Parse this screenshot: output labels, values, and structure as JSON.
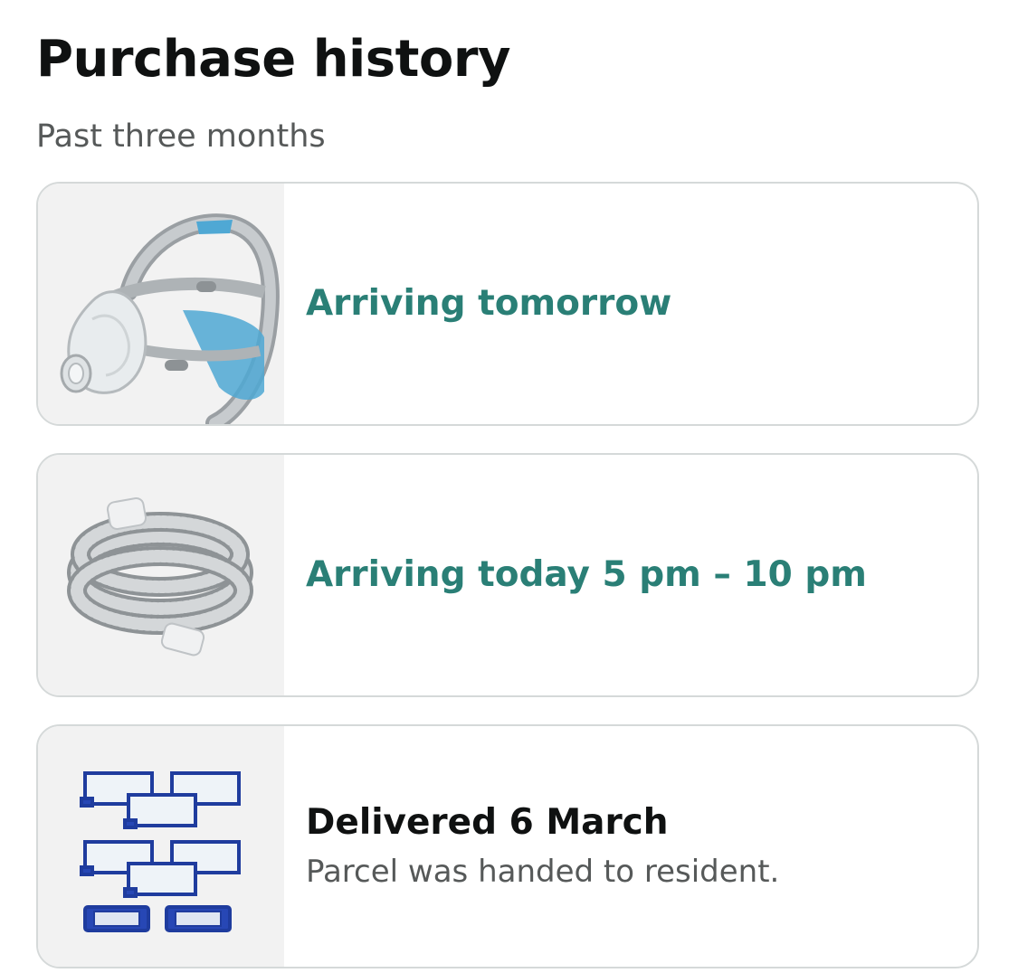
{
  "header": {
    "title": "Purchase history",
    "subtitle": "Past three months"
  },
  "orders": [
    {
      "status": "Arriving tomorrow",
      "status_color": "#2a7f76",
      "detail": "",
      "thumbnail_icon": "cpap-mask-icon"
    },
    {
      "status": "Arriving today 5 pm – 10 pm",
      "status_color": "#2a7f76",
      "detail": "",
      "thumbnail_icon": "cpap-tubing-icon"
    },
    {
      "status": "Delivered 6 March",
      "status_color": "#0f1111",
      "detail": "Parcel was handed to resident.",
      "thumbnail_icon": "cpap-filters-icon"
    }
  ],
  "colors": {
    "accent_green": "#2a7f76",
    "text_primary": "#0f1111",
    "text_secondary": "#565959",
    "card_border": "#d5d9d9",
    "thumb_background": "#f2f2f2"
  }
}
